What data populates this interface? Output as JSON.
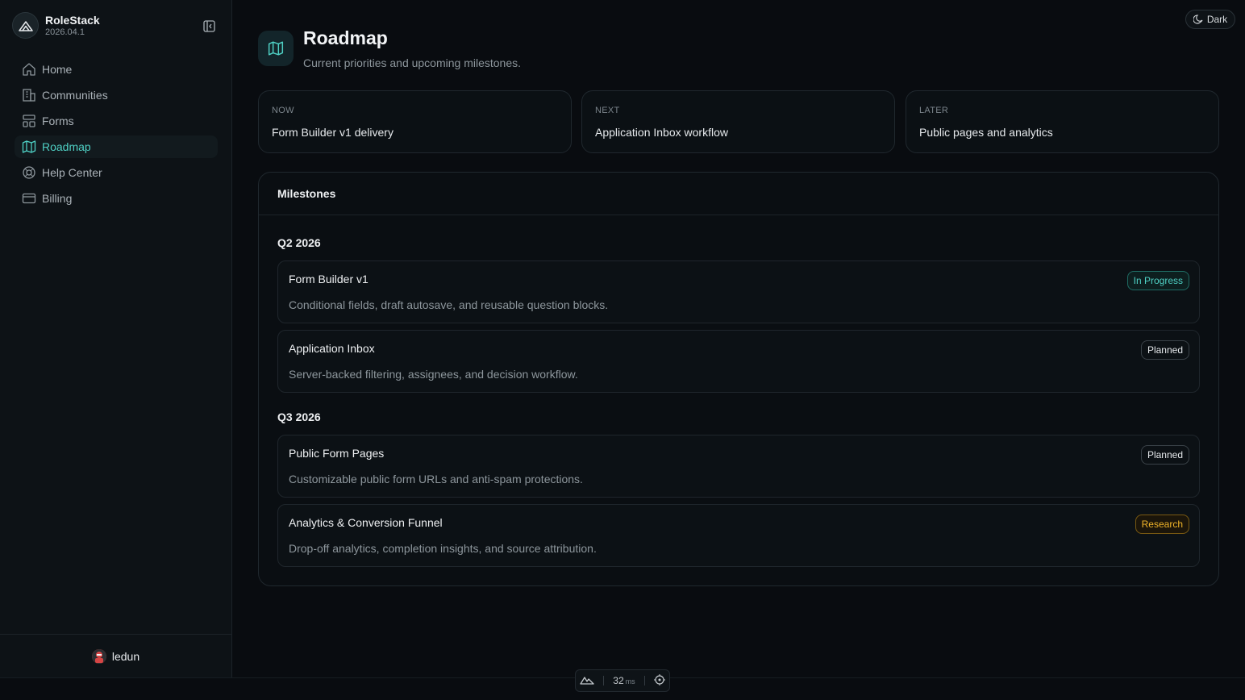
{
  "app": {
    "name": "RoleStack",
    "version": "2026.04.1"
  },
  "sidebar": {
    "items": [
      {
        "label": "Home",
        "icon": "home-icon",
        "active": false
      },
      {
        "label": "Communities",
        "icon": "building-icon",
        "active": false
      },
      {
        "label": "Forms",
        "icon": "layout-icon",
        "active": false
      },
      {
        "label": "Roadmap",
        "icon": "map-icon",
        "active": true
      },
      {
        "label": "Help Center",
        "icon": "lifebuoy-icon",
        "active": false
      },
      {
        "label": "Billing",
        "icon": "credit-card-icon",
        "active": false
      }
    ],
    "user": {
      "name": "ledun"
    }
  },
  "theme_toggle": {
    "label": "Dark",
    "icon": "moon-icon"
  },
  "header": {
    "title": "Roadmap",
    "subtitle": "Current priorities and upcoming milestones.",
    "icon": "map-icon"
  },
  "priorities": [
    {
      "label": "NOW",
      "value": "Form Builder v1 delivery"
    },
    {
      "label": "NEXT",
      "value": "Application Inbox workflow"
    },
    {
      "label": "LATER",
      "value": "Public pages and analytics"
    }
  ],
  "milestones": {
    "title": "Milestones",
    "quarters": [
      {
        "name": "Q2 2026",
        "items": [
          {
            "title": "Form Builder v1",
            "desc": "Conditional fields, draft autosave, and reusable question blocks.",
            "status": "In Progress"
          },
          {
            "title": "Application Inbox",
            "desc": "Server-backed filtering, assignees, and decision workflow.",
            "status": "Planned"
          }
        ]
      },
      {
        "name": "Q3 2026",
        "items": [
          {
            "title": "Public Form Pages",
            "desc": "Customizable public form URLs and anti-spam protections.",
            "status": "Planned"
          },
          {
            "title": "Analytics & Conversion Funnel",
            "desc": "Drop-off analytics, completion insights, and source attribution.",
            "status": "Research"
          }
        ]
      }
    ]
  },
  "devbar": {
    "timing": "32",
    "unit": "ms"
  },
  "colors": {
    "accent": "#4fd1c5",
    "research": "#f0b429",
    "background": "#090c10"
  }
}
